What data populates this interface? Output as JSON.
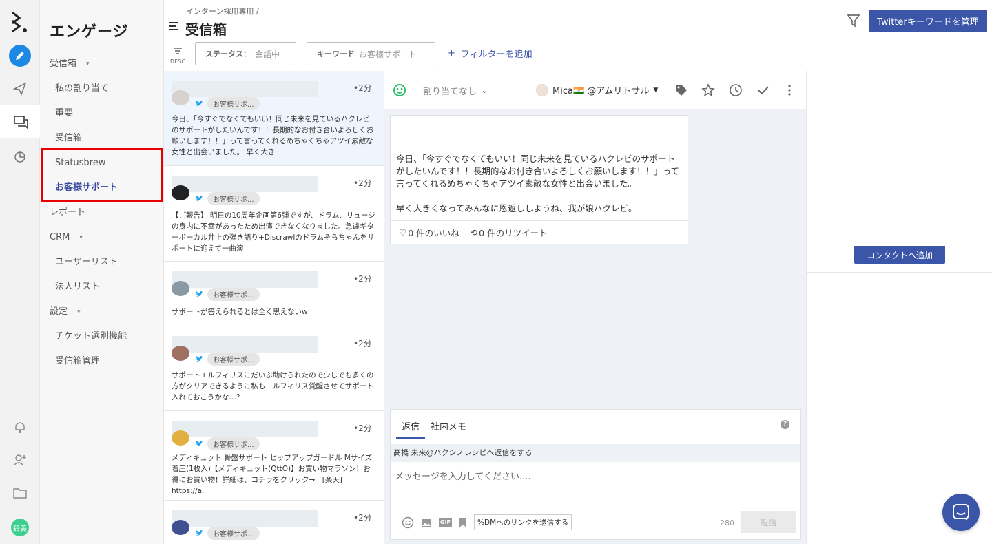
{
  "app": {
    "brand_color": "#3b55a8",
    "highlight_color": "#e60000"
  },
  "rail": {
    "avatar_text": "鈴美"
  },
  "nav": {
    "title": "エンゲージ",
    "inbox_group": "受信箱",
    "my_assign": "私の割り当て",
    "important": "重要",
    "inbox": "受信箱",
    "statusbrew": "Statusbrew",
    "customer_support": "お客様サポート",
    "report": "レポート",
    "crm": "CRM",
    "user_list": "ユーザーリスト",
    "corp_list": "法人リスト",
    "settings": "設定",
    "ticket": "チケット選別機能",
    "inbox_manage": "受信箱管理"
  },
  "header": {
    "breadcrumb": "インターン採用専用 /",
    "title": "受信箱",
    "twitter_button": "Twitterキーワードを管理",
    "sort_label": "DESC",
    "status_key": "ステータス：",
    "status_value": "会話中",
    "keyword_key": "キーワード",
    "keyword_value": "お客様サポート",
    "add_filter": "フィルターを追加"
  },
  "conversations": [
    {
      "time": "•2分",
      "tag": "お客様サポ...",
      "text": "今日、「今すぐでなくてもいい！同じ未来を見ているハクレビのサポートがしたいんです！！長期的なお付き合いよろしくお願いします！！」って言ってくれるめちゃくちゃアツイ素敵な女性と出会いました。 早く大き"
    },
    {
      "time": "•2分",
      "tag": "お客様サポ...",
      "text": "【ご報告】 明日の10周年企画第6弾ですが、ドラム、リュージの身内に不幸があったため出演できなくなりました。急遽ギターボーカル井上の弾き語り+Discrawlのドラムそらちゃんをサポートに迎えて一曲演"
    },
    {
      "time": "•2分",
      "tag": "お客様サポ...",
      "text": "サポートが答えられるとは全く思えないw"
    },
    {
      "time": "•2分",
      "tag": "お客様サポ...",
      "text": "サポートエルフィリスにだいぶ助けられたので少しでも多くの方がクリアできるように私もエルフィリス覚醒させてサポート入れておこうかな…？"
    },
    {
      "time": "•2分",
      "tag": "お客様サポ...",
      "text": "メディキュット 骨盤サポート ヒップアップガードル Mサイズ 着圧(1枚入)【メディキュット(QttO)】お買い物マラソン！お得にお買い物！詳細は、コチラをクリック→　[楽天] https://a."
    },
    {
      "time": "•2分",
      "tag": "お客様サポ...",
      "text": ""
    }
  ],
  "conversation": {
    "assign": "割り当てなし",
    "user": "Mica🇮🇳 @アムリトサル",
    "message_line1": "今日、「今すぐでなくてもいい！同じ未来を見ているハクレビのサポートがしたいんです！！長期的なお付き合いよろしくお願いします！！」って言ってくれるめちゃくちゃアツイ素敵な女性と出会いました。",
    "message_line2": "早く大きくなってみんなに恩返ししようね、我が娘ハクレビ。",
    "likes": "0 件のいいね",
    "retweets": "0 件のリツイート"
  },
  "reply": {
    "tab_reply": "返信",
    "tab_memo": "社内メモ",
    "reply_to": "髙橋 未来@ハクシノレシピへ返信をする",
    "placeholder": "メッセージを入力してください....",
    "dm_link": "DMへのリンクを送信する",
    "char_count": "280",
    "send": "返信",
    "gif": "GIF"
  },
  "right_panel": {
    "add_contact": "コンタクトへ追加"
  }
}
